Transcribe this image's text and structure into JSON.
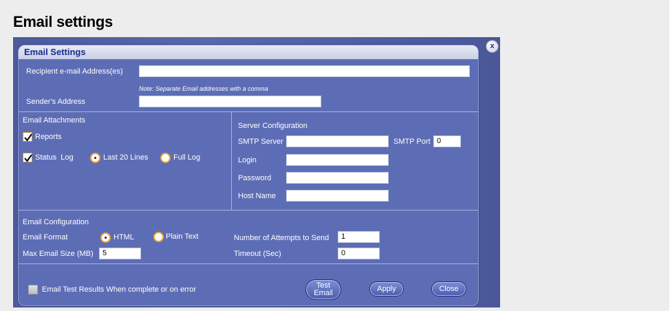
{
  "page": {
    "title": "Email settings"
  },
  "dialog": {
    "title": "Email Settings",
    "close_glyph": "x",
    "recipient": {
      "label": "Recipient e-mail Address(es)",
      "value": ""
    },
    "note": "Note: Separate Email addresses with a comma",
    "sender": {
      "label": "Sender's Address",
      "value": ""
    },
    "attachments": {
      "heading": "Email Attachments",
      "reports": {
        "label": "Reports",
        "checked": true
      },
      "status_log": {
        "label": "Status  Log",
        "checked": true
      },
      "log_options": [
        {
          "label": "Last 20 Lines",
          "selected": true
        },
        {
          "label": "Full Log",
          "selected": false
        }
      ]
    },
    "server": {
      "heading": "Server Configuration",
      "smtp_server": {
        "label": "SMTP Server",
        "value": ""
      },
      "smtp_port": {
        "label": "SMTP Port",
        "value": "0"
      },
      "login": {
        "label": "Login",
        "value": ""
      },
      "password": {
        "label": "Password",
        "value": ""
      },
      "host_name": {
        "label": "Host Name",
        "value": ""
      }
    },
    "config": {
      "heading": "Email Configuration",
      "format_label": "Email Format",
      "format_options": [
        {
          "label": "HTML",
          "selected": true
        },
        {
          "label": "Plain Text",
          "selected": false
        }
      ],
      "max_size": {
        "label": "Max Email Size (MB)",
        "value": "5"
      },
      "attempts": {
        "label": "Number of Attempts to Send",
        "value": "1"
      },
      "timeout": {
        "label": "Timeout (Sec)",
        "value": "0"
      }
    },
    "footer": {
      "email_test_results": {
        "label": "Email Test Results When complete or on error",
        "checked": false
      },
      "test_email_line1": "Test",
      "test_email_line2": "Email",
      "apply": "Apply",
      "close": "Close"
    }
  },
  "colors": {
    "dialog_body": "#5d6db5",
    "title_text": "#1a2a8c",
    "radio_ring": "#f0a830",
    "checkbox_border": "#c8953a"
  }
}
